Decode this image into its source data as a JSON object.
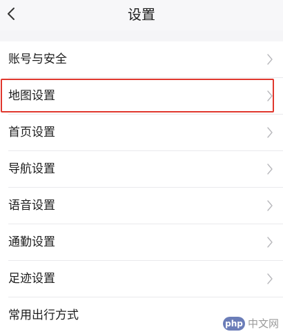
{
  "header": {
    "title": "设置",
    "back_icon": "chevron-left-icon"
  },
  "settings": {
    "items": [
      {
        "label": "账号与安全",
        "icon": "chevron-right-icon"
      },
      {
        "label": "地图设置",
        "icon": "chevron-right-icon"
      },
      {
        "label": "首页设置",
        "icon": "chevron-right-icon"
      },
      {
        "label": "导航设置",
        "icon": "chevron-right-icon"
      },
      {
        "label": "语音设置",
        "icon": "chevron-right-icon"
      },
      {
        "label": "通勤设置",
        "icon": "chevron-right-icon"
      },
      {
        "label": "足迹设置",
        "icon": "chevron-right-icon"
      },
      {
        "label": "常用出行方式"
      }
    ],
    "highlighted_item": "地图设置"
  },
  "colors": {
    "highlight_border": "#e0362c",
    "chevron": "#b8b8bc"
  },
  "watermark": {
    "badge": "php",
    "text": "中文网"
  }
}
